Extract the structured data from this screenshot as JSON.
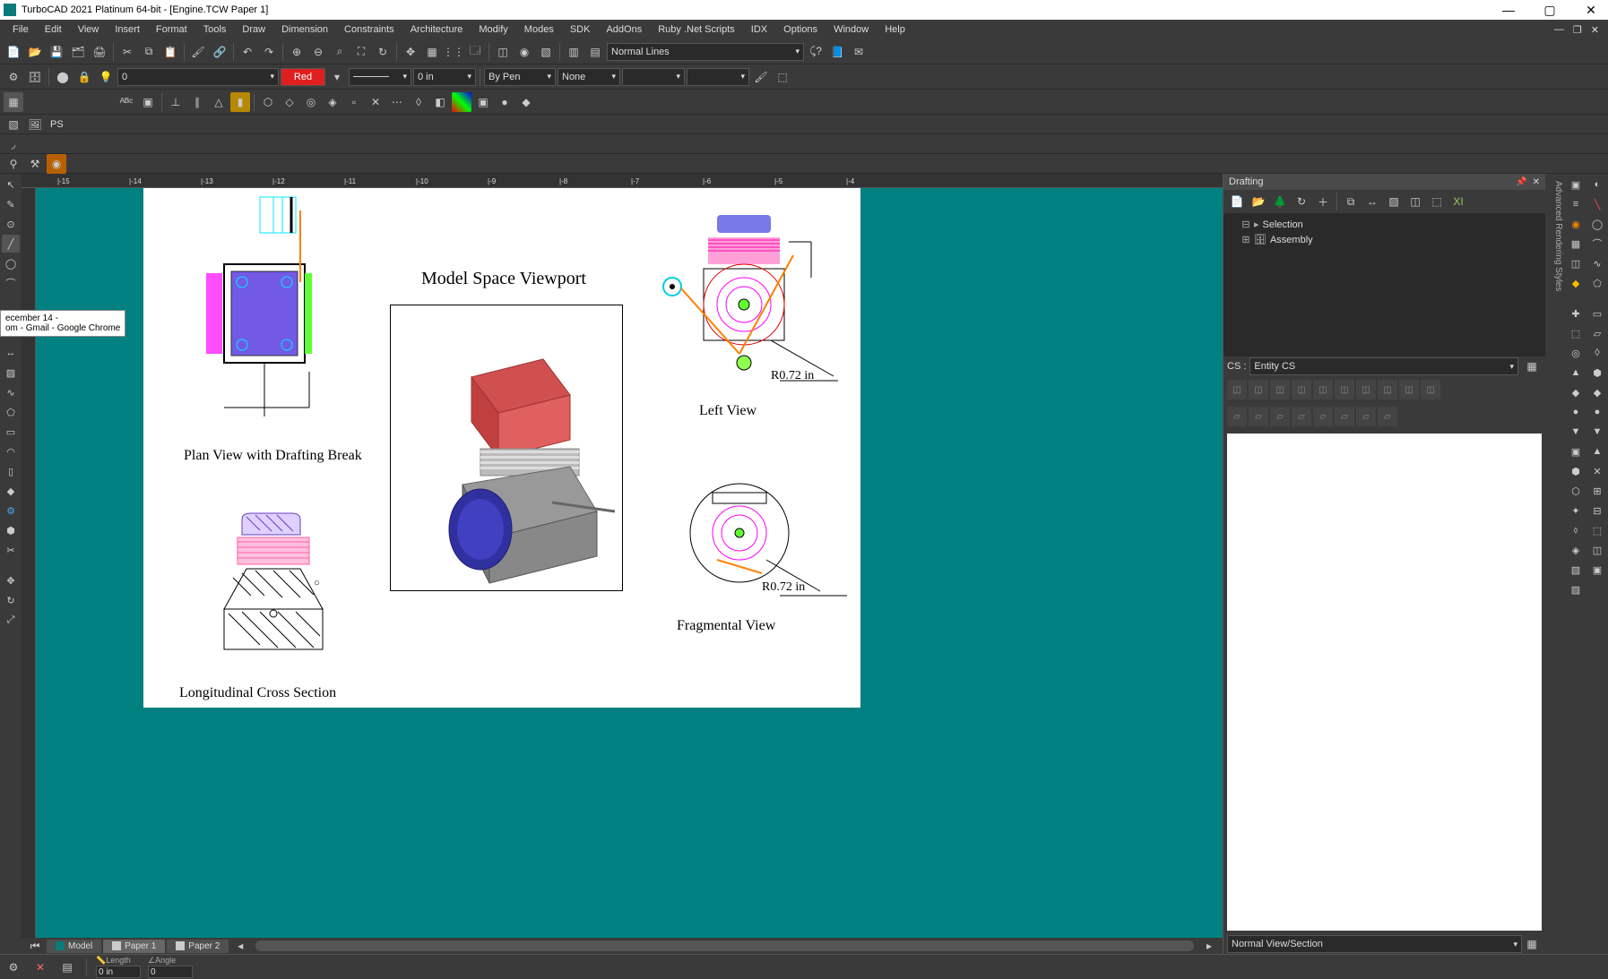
{
  "titlebar": {
    "title": "TurboCAD 2021 Platinum 64-bit - [Engine.TCW Paper 1]"
  },
  "menu": [
    "File",
    "Edit",
    "View",
    "Insert",
    "Format",
    "Tools",
    "Draw",
    "Dimension",
    "Constraints",
    "Architecture",
    "Modify",
    "Modes",
    "SDK",
    "AddOns",
    "Ruby .Net Scripts",
    "IDX",
    "Options",
    "Window",
    "Help"
  ],
  "toolbar2": {
    "layer_value": "0",
    "linetype_label": "Normal Lines"
  },
  "props": {
    "color_name": "Red",
    "color_hex": "#e02020",
    "width_value": "0 in",
    "by_pen": "By Pen",
    "style": "None"
  },
  "sidebar_ps": "PS",
  "tooltip": {
    "line1": "ecember 14 -",
    "line2": "om - Gmail - Google Chrome"
  },
  "canvas": {
    "viewport_title": "Model Space Viewport",
    "plan_label": "Plan View with Drafting Break",
    "left_label": "Left View",
    "long_label": "Longitudinal Cross Section",
    "frag_label": "Fragmental View",
    "dim1": "R0.72 in",
    "dim2": "R0.72 in"
  },
  "tabs": {
    "model": "Model",
    "paper1": "Paper 1",
    "paper2": "Paper 2"
  },
  "status": {
    "length_label": "Length",
    "angle_label": "Angle",
    "length_val": "0 in",
    "angle_val": "0"
  },
  "panel": {
    "title": "Drafting",
    "tree": {
      "selection": "Selection",
      "assembly": "Assembly"
    },
    "cs_label": "CS :",
    "cs_value": "Entity CS",
    "section": "Normal View/Section"
  },
  "right_tab_label": "Advanced Rendering Styles"
}
